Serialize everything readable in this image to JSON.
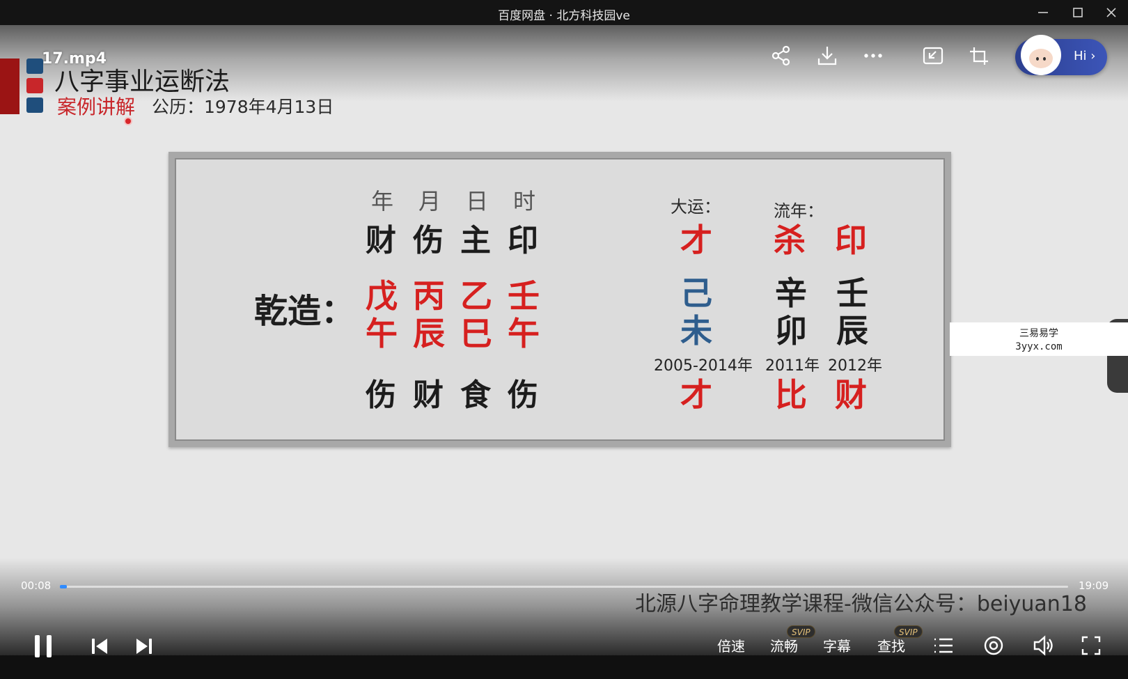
{
  "window": {
    "title": "百度网盘 · 北方科技园ve"
  },
  "video": {
    "file_name": "17.mp4",
    "slide": {
      "title": "八字事业运断法",
      "subtitle": "案例讲解",
      "date": "公历：1978年4月13日",
      "pillar_headers": [
        "年",
        "月",
        "日",
        "时"
      ],
      "ten_gods_top": [
        "财",
        "伤",
        "主",
        "印"
      ],
      "qian_label": "乾造：",
      "stems": [
        "戊",
        "丙",
        "乙",
        "壬"
      ],
      "branches": [
        "午",
        "辰",
        "巳",
        "午"
      ],
      "ten_gods_bottom": [
        "伤",
        "财",
        "食",
        "伤"
      ],
      "dayun_label": "大运：",
      "liunian_label": "流年：",
      "dayun": {
        "top": "才",
        "stem": "己",
        "branch": "未",
        "years": "2005-2014年",
        "bottom": "才"
      },
      "liunian": [
        {
          "top": "杀",
          "stem": "辛",
          "branch": "卯",
          "year": "2011年",
          "bottom": "比"
        },
        {
          "top": "印",
          "stem": "壬",
          "branch": "辰",
          "year": "2012年",
          "bottom": "财"
        }
      ]
    },
    "watermark": {
      "line1": "三易易学",
      "line2": "3yyx.com"
    },
    "caption": "北源八字命理教学课程-微信公众号：beiyuan18",
    "hi_badge": "Hi"
  },
  "player": {
    "current_time": "00:08",
    "total_time": "19:09",
    "progress": 0.007,
    "speed_label": "倍速",
    "quality_label": "流畅",
    "subtitle_label": "字幕",
    "search_label": "查找",
    "svip_badge": "SVIP"
  },
  "colors": {
    "accent": "#2f8bff",
    "slide_red": "#d6201f",
    "slide_blue": "#2e5d8d",
    "logo_red": "#9b1414"
  }
}
